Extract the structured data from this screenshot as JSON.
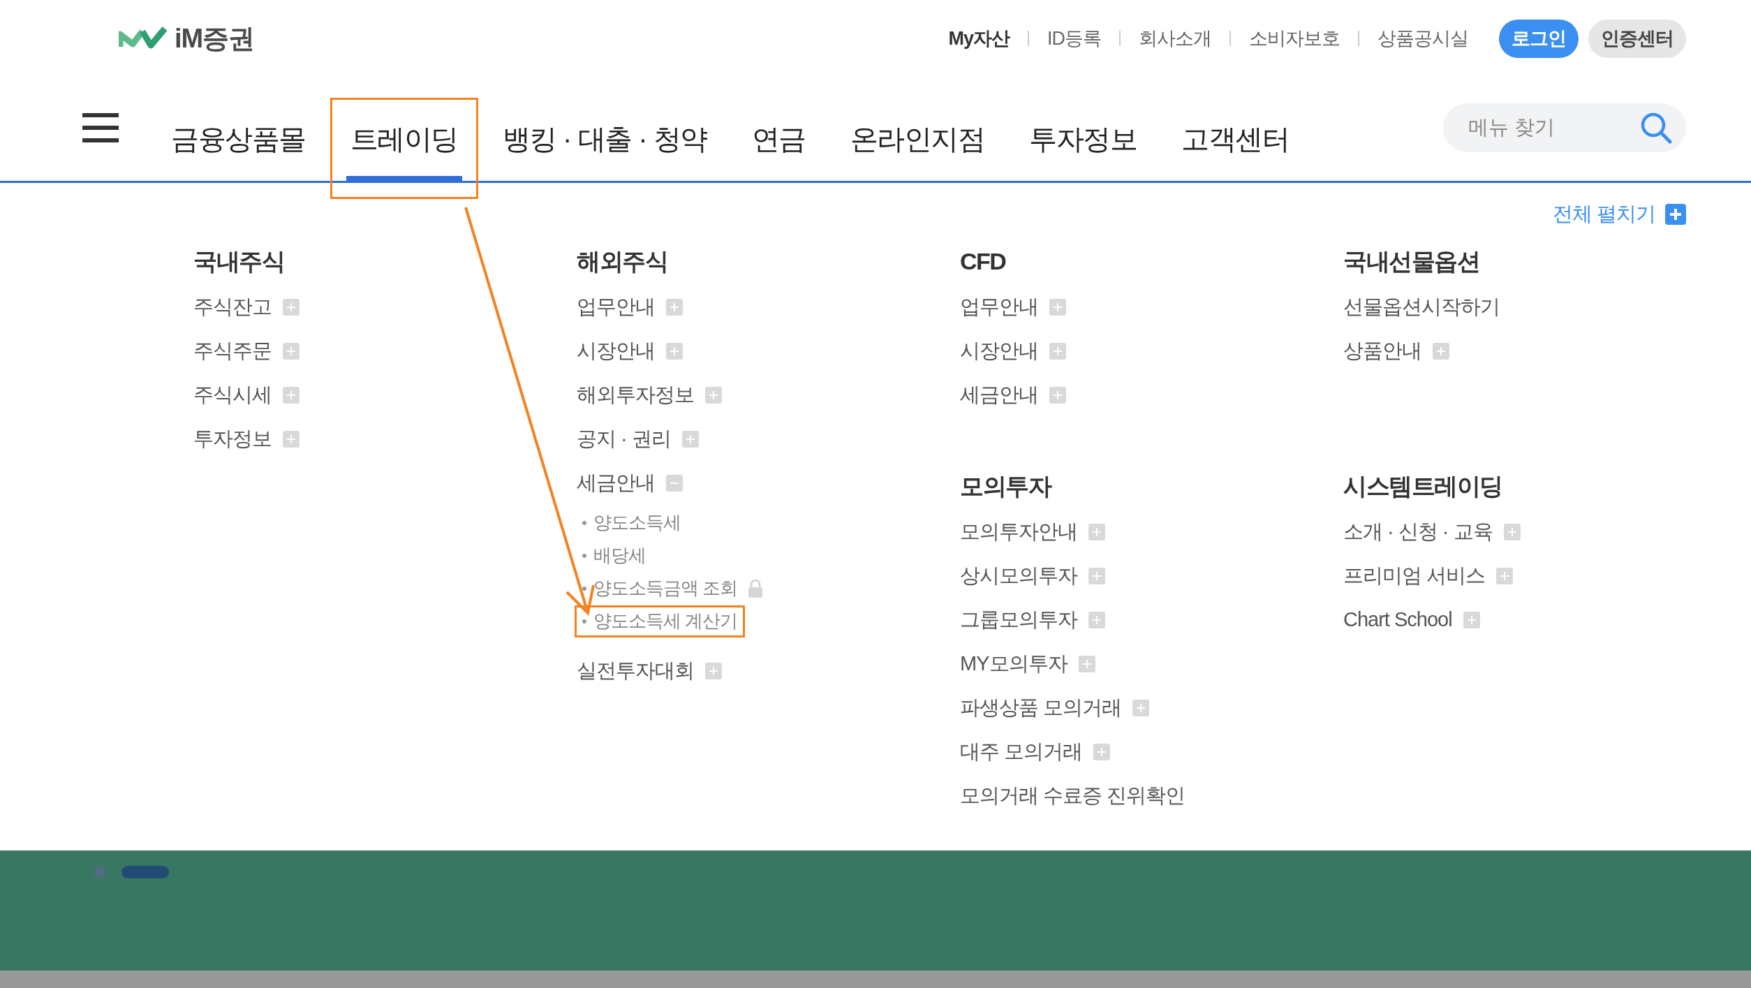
{
  "logo": {
    "text": "iM증권"
  },
  "utility_links": [
    {
      "label": "My자산",
      "bold": true
    },
    {
      "label": "ID등록",
      "bold": false
    },
    {
      "label": "회사소개",
      "bold": false
    },
    {
      "label": "소비자보호",
      "bold": false
    },
    {
      "label": "상품공시실",
      "bold": false
    }
  ],
  "header_buttons": [
    {
      "label": "로그인",
      "kind": "primary"
    },
    {
      "label": "인증센터",
      "kind": "secondary"
    }
  ],
  "nav": [
    {
      "label": "금융상품몰",
      "selected": false,
      "highlighted": false
    },
    {
      "label": "트레이딩",
      "selected": true,
      "highlighted": true
    },
    {
      "label": "뱅킹 · 대출 · 청약",
      "selected": false,
      "highlighted": false
    },
    {
      "label": "연금",
      "selected": false,
      "highlighted": false
    },
    {
      "label": "온라인지점",
      "selected": false,
      "highlighted": false
    },
    {
      "label": "투자정보",
      "selected": false,
      "highlighted": false
    },
    {
      "label": "고객센터",
      "selected": false,
      "highlighted": false
    }
  ],
  "search": {
    "placeholder": "메뉴 찾기"
  },
  "expand_all": {
    "label": "전체 펼치기"
  },
  "columns": [
    {
      "groups": [
        {
          "title": "국내주식",
          "items": [
            {
              "label": "주식잔고",
              "kind": "toggle",
              "expanded": false
            },
            {
              "label": "주식주문",
              "kind": "toggle",
              "expanded": false
            },
            {
              "label": "주식시세",
              "kind": "toggle",
              "expanded": false
            },
            {
              "label": "투자정보",
              "kind": "toggle",
              "expanded": false
            }
          ]
        }
      ]
    },
    {
      "groups": [
        {
          "title": "해외주식",
          "items": [
            {
              "label": "업무안내",
              "kind": "toggle",
              "expanded": false
            },
            {
              "label": "시장안내",
              "kind": "toggle",
              "expanded": false
            },
            {
              "label": "해외투자정보",
              "kind": "toggle",
              "expanded": false
            },
            {
              "label": "공지 · 권리",
              "kind": "toggle",
              "expanded": false
            },
            {
              "label": "세금안내",
              "kind": "toggle",
              "expanded": true,
              "children": [
                {
                  "label": "양도소득세",
                  "locked": false,
                  "highlighted": false
                },
                {
                  "label": "배당세",
                  "locked": false,
                  "highlighted": false
                },
                {
                  "label": "양도소득금액 조회",
                  "locked": true,
                  "highlighted": false
                },
                {
                  "label": "양도소득세 계산기",
                  "locked": false,
                  "highlighted": true
                }
              ]
            },
            {
              "label": "실전투자대회",
              "kind": "toggle",
              "expanded": false
            }
          ]
        }
      ]
    },
    {
      "groups": [
        {
          "title": "CFD",
          "items": [
            {
              "label": "업무안내",
              "kind": "toggle",
              "expanded": false
            },
            {
              "label": "시장안내",
              "kind": "toggle",
              "expanded": false
            },
            {
              "label": "세금안내",
              "kind": "toggle",
              "expanded": false
            }
          ]
        },
        {
          "title": "모의투자",
          "items": [
            {
              "label": "모의투자안내",
              "kind": "toggle",
              "expanded": false
            },
            {
              "label": "상시모의투자",
              "kind": "toggle",
              "expanded": false
            },
            {
              "label": "그룹모의투자",
              "kind": "toggle",
              "expanded": false
            },
            {
              "label": "MY모의투자",
              "kind": "toggle",
              "expanded": false
            },
            {
              "label": "파생상품 모의거래",
              "kind": "toggle",
              "expanded": false
            },
            {
              "label": "대주 모의거래",
              "kind": "toggle",
              "expanded": false
            },
            {
              "label": "모의거래 수료증 진위확인",
              "kind": "link"
            }
          ]
        }
      ]
    },
    {
      "groups": [
        {
          "title": "국내선물옵션",
          "items": [
            {
              "label": "선물옵션시작하기",
              "kind": "link"
            },
            {
              "label": "상품안내",
              "kind": "toggle",
              "expanded": false
            }
          ]
        },
        {
          "title": "시스템트레이딩",
          "items": [
            {
              "label": "소개 · 신청 · 교육",
              "kind": "toggle",
              "expanded": false
            },
            {
              "label": "프리미엄 서비스",
              "kind": "toggle",
              "expanded": false
            },
            {
              "label": "Chart School",
              "kind": "toggle",
              "expanded": false
            }
          ]
        }
      ]
    }
  ],
  "banner_pager": [
    {
      "selected": false
    },
    {
      "selected": true
    }
  ]
}
